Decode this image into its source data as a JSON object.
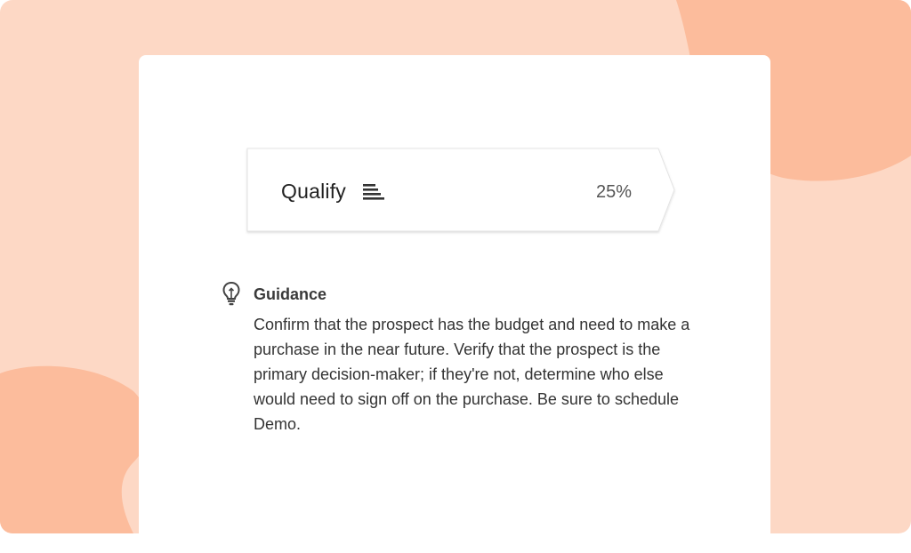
{
  "theme": {
    "background": "#fdd8c5",
    "blob": "#fcbc9c",
    "card": "#ffffff"
  },
  "stage": {
    "label": "Qualify",
    "percent": "25%",
    "icon": "list-lines-icon"
  },
  "guidance": {
    "icon": "lightbulb-icon",
    "title": "Guidance",
    "text": "Confirm that the prospect has the budget and need to make a purchase in the near future. Verify that the prospect is the primary decision-maker; if they're not, determine who else would need to sign off on the purchase. Be sure to schedule Demo."
  }
}
